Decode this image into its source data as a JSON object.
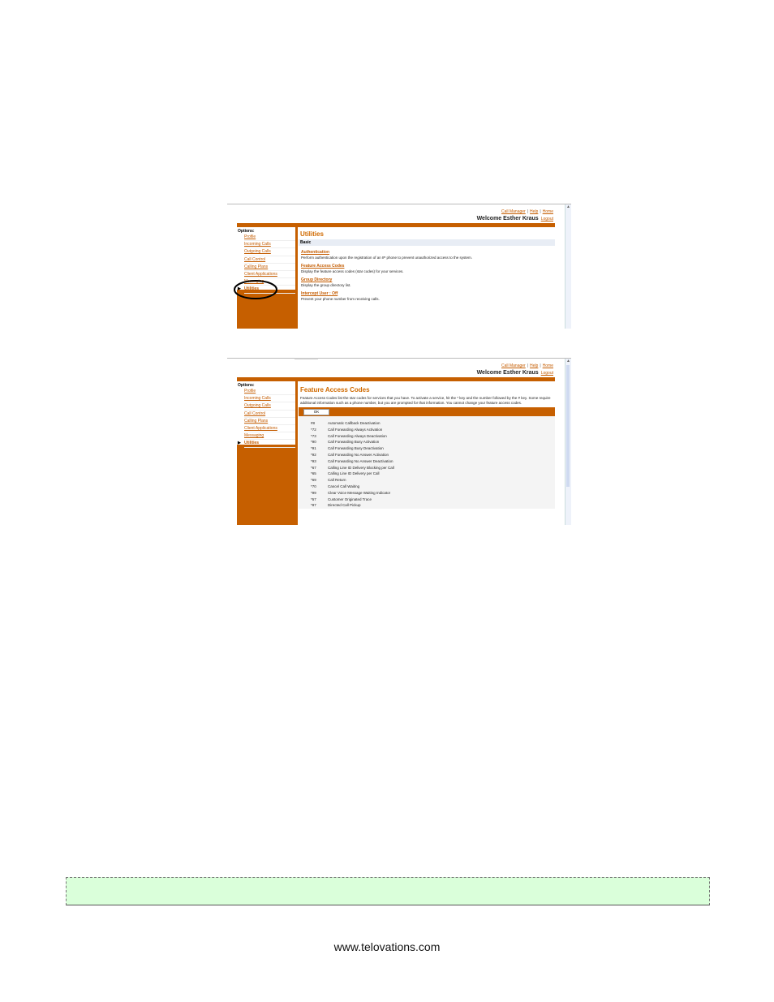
{
  "header_links": [
    "Call Manager",
    "Help",
    "Home"
  ],
  "welcome": "Welcome Esther Kraus",
  "logout": "Logout",
  "options_label": "Options:",
  "sidebar1": [
    "Profile",
    "Incoming Calls",
    "Outgoing Calls",
    "Call Control",
    "Calling Plans",
    "Client Applications",
    "Messaging",
    "Utilities"
  ],
  "sidebar2": [
    "Profile",
    "Incoming Calls",
    "Outgoing Calls",
    "Call Control",
    "Calling Plans",
    "Client Applications",
    "Messaging",
    "Utilities"
  ],
  "utilities": {
    "title": "Utilities",
    "section": "Basic",
    "items": [
      {
        "link": "Authentication",
        "desc": "Perform authentication upon the registration of an IP phone to prevent unauthorized access to the system."
      },
      {
        "link": "Feature Access Codes",
        "desc": "Display the feature access codes (star codes) for your services."
      },
      {
        "link": "Group Directory",
        "desc": "Display the group directory list."
      },
      {
        "link": "Intercept User : Off",
        "desc": "Prevent your phone number from receiving calls."
      }
    ]
  },
  "fac": {
    "title": "Feature Access Codes",
    "intro": "Feature Access Codes list the star codes for services that you have. To activate a service, hit the * key and the number followed by the # key. Some require additional information such as a phone number, but you are prompted for that information. You cannot change your feature access codes.",
    "ok": "OK",
    "codes": [
      {
        "code": "#8",
        "name": "Automatic Callback Deactivation"
      },
      {
        "code": "*72",
        "name": "Call Forwarding Always Activation"
      },
      {
        "code": "*73",
        "name": "Call Forwarding Always Deactivation"
      },
      {
        "code": "*90",
        "name": "Call Forwarding Busy Activation"
      },
      {
        "code": "*91",
        "name": "Call Forwarding Busy Deactivation"
      },
      {
        "code": "*92",
        "name": "Call Forwarding No Answer Activation"
      },
      {
        "code": "*93",
        "name": "Call Forwarding No Answer Deactivation"
      },
      {
        "code": "*67",
        "name": "Calling Line ID Delivery Blocking per Call"
      },
      {
        "code": "*65",
        "name": "Calling Line ID Delivery per Call"
      },
      {
        "code": "*69",
        "name": "Call Return"
      },
      {
        "code": "*70",
        "name": "Cancel Call Waiting"
      },
      {
        "code": "*99",
        "name": "Clear Voice Message Waiting Indicator"
      },
      {
        "code": "*57",
        "name": "Customer Originated Trace"
      },
      {
        "code": "*97",
        "name": "Directed Call Pickup"
      }
    ]
  },
  "website": "www.telovations.com"
}
